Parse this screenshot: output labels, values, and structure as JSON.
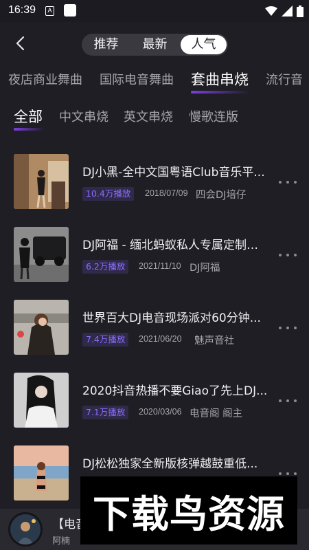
{
  "status_bar": {
    "time": "16:39",
    "notif_letter": "A"
  },
  "header": {
    "segments": [
      {
        "label": "推荐",
        "active": false
      },
      {
        "label": "最新",
        "active": false
      },
      {
        "label": "人气",
        "active": true
      }
    ]
  },
  "categories": [
    {
      "label": "夜店商业舞曲",
      "active": false
    },
    {
      "label": "国际电音舞曲",
      "active": false
    },
    {
      "label": "套曲串烧",
      "active": true
    },
    {
      "label": "流行音",
      "active": false
    }
  ],
  "sub_categories": [
    {
      "label": "全部",
      "active": true
    },
    {
      "label": "中文串烧",
      "active": false
    },
    {
      "label": "英文串烧",
      "active": false
    },
    {
      "label": "慢歌连版",
      "active": false
    }
  ],
  "tracks": [
    {
      "title": "DJ小黑-全中文国粤语Club音乐平...",
      "plays": "10.4万播放",
      "date": "2018/07/09",
      "author": "四会DJ培仔"
    },
    {
      "title": "DJ阿福 - 缅北蚂蚁私人专属定制送...",
      "plays": "6.2万播放",
      "date": "2021/11/10",
      "author": "DJ阿福"
    },
    {
      "title": "世界百大DJ电音现场派对60分钟...",
      "plays": "7.4万播放",
      "date": "2021/06/20",
      "author": "魅声音社"
    },
    {
      "title": "2020抖音热播不要Giao了先上DJ...",
      "plays": "7.1万播放",
      "date": "2020/03/06",
      "author": "电音阁 阁主"
    },
    {
      "title": "DJ松松独家全新版核弹越鼓重低...",
      "plays": "",
      "date": "",
      "author": ""
    }
  ],
  "player": {
    "title": "【电音",
    "artist": "阿楠"
  },
  "watermark": {
    "text": "下载鸟资源"
  },
  "colors": {
    "background": "#1f1e24",
    "accent": "#7b3fe4",
    "badge_text": "#8c6cff",
    "badge_bg": "#2f2a4a"
  }
}
